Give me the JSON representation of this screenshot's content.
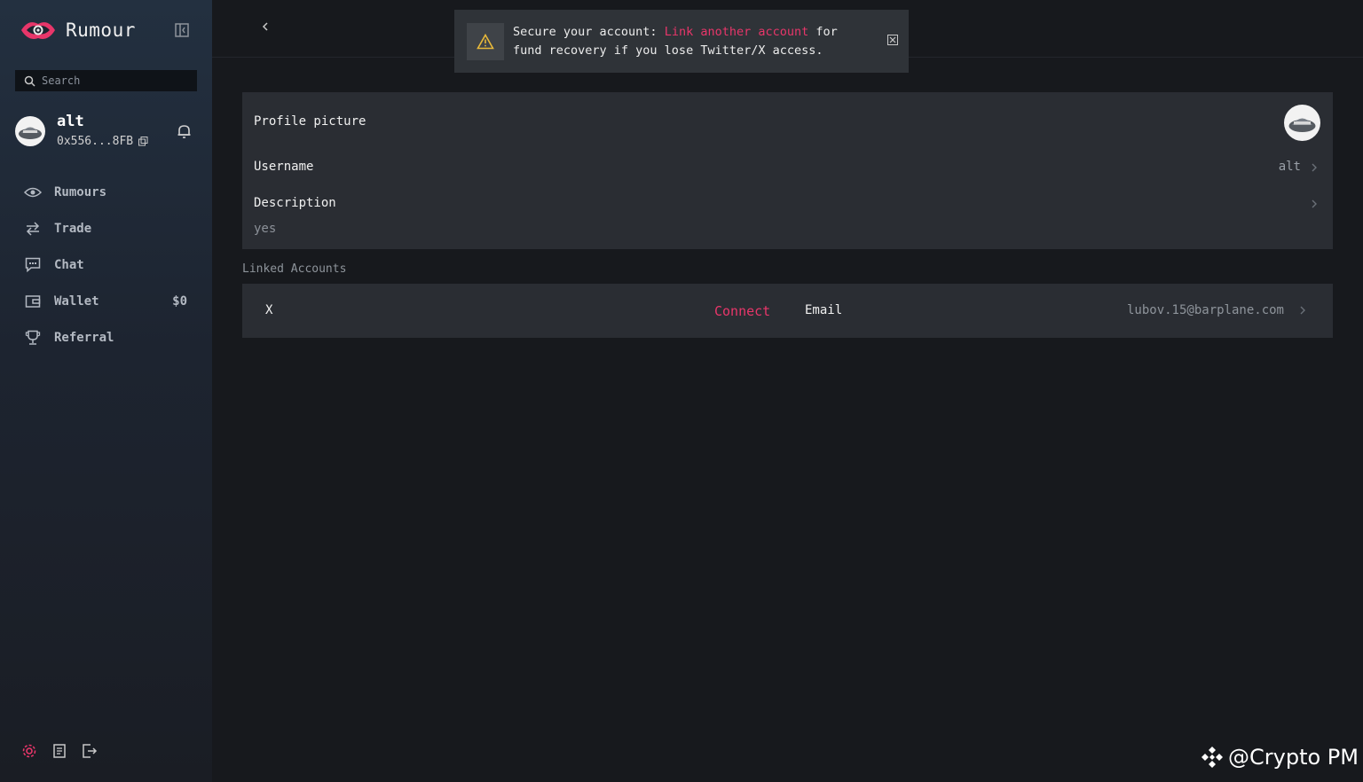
{
  "app": {
    "name": "Rumour"
  },
  "search": {
    "placeholder": "Search"
  },
  "user": {
    "name": "alt",
    "address": "0x556...8FB"
  },
  "nav": [
    {
      "label": "Rumours",
      "icon": "eye-icon"
    },
    {
      "label": "Trade",
      "icon": "swap-icon"
    },
    {
      "label": "Chat",
      "icon": "chat-icon"
    },
    {
      "label": "Wallet",
      "icon": "wallet-icon",
      "extra": "$0"
    },
    {
      "label": "Referral",
      "icon": "trophy-icon"
    }
  ],
  "toast": {
    "prefix": "Secure your account: ",
    "link": "Link another account",
    "suffix": " for fund recovery if you lose Twitter/X access."
  },
  "profile": {
    "picture_label": "Profile picture",
    "username_label": "Username",
    "username_value": "alt",
    "description_label": "Description",
    "description_value": "yes"
  },
  "linked": {
    "section_title": "Linked Accounts",
    "x_label": "X",
    "connect_label": "Connect",
    "email_label": "Email",
    "email_value": "lubov.15@barplane.com"
  },
  "watermark": {
    "text": "@Crypto PM"
  },
  "colors": {
    "accent": "#e8366a",
    "sidebar_top": "#233040",
    "background": "#17191d",
    "card": "#2a2d33"
  }
}
